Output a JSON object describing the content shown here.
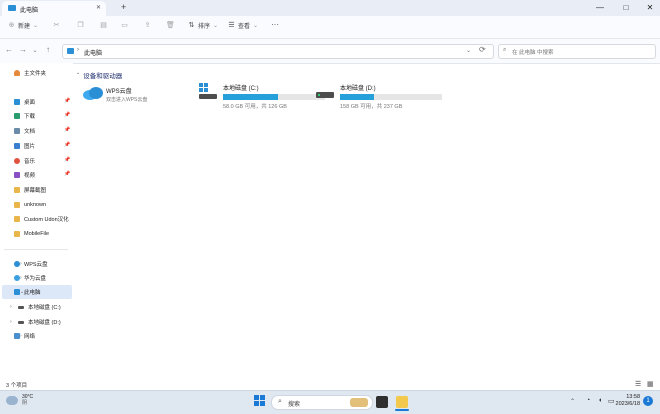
{
  "window": {
    "tab_title": "此电脑",
    "new_tab": "+",
    "minimize": "—",
    "maximize": "□",
    "close": "✕"
  },
  "toolbar": {
    "new_label": "新建",
    "sort_label": "排序",
    "view_label": "查看",
    "more_label": "···"
  },
  "address": {
    "path": "此电脑",
    "search_placeholder": "在 此电脑 中搜索"
  },
  "sidebar": {
    "home": "主文件夹",
    "items": [
      "桌面",
      "下载",
      "文档",
      "图片",
      "音乐",
      "视频",
      "屏幕截图",
      "unknown",
      "Custom Udon汉化",
      "MobileFile"
    ],
    "clouds": [
      "WPS云盘",
      "华为云盘"
    ],
    "this_pc": "此电脑",
    "drives": [
      "本地磁盘 (C:)",
      "本地磁盘 (D:)"
    ],
    "network": "网络"
  },
  "content": {
    "group_title": "设备和驱动器",
    "wps": {
      "name": "WPS云盘",
      "desc": "双击进入WPS云盘"
    },
    "drives": [
      {
        "name": "本地磁盘 (C:)",
        "size": "58.0 GB 可用，共 126 GB",
        "used_fraction": 0.54
      },
      {
        "name": "本地磁盘 (D:)",
        "size": "158 GB 可用，共 237 GB",
        "used_fraction": 0.33
      }
    ]
  },
  "status": {
    "count": "3 个项目"
  },
  "taskbar": {
    "weather_temp": "30°C",
    "weather_desc": "阴",
    "search_label": "搜索",
    "time": "13:58",
    "date": "2023/6/18",
    "notify_count": "1"
  },
  "colors": {
    "accent": "#26a0da",
    "folder": "#e8b64a"
  }
}
